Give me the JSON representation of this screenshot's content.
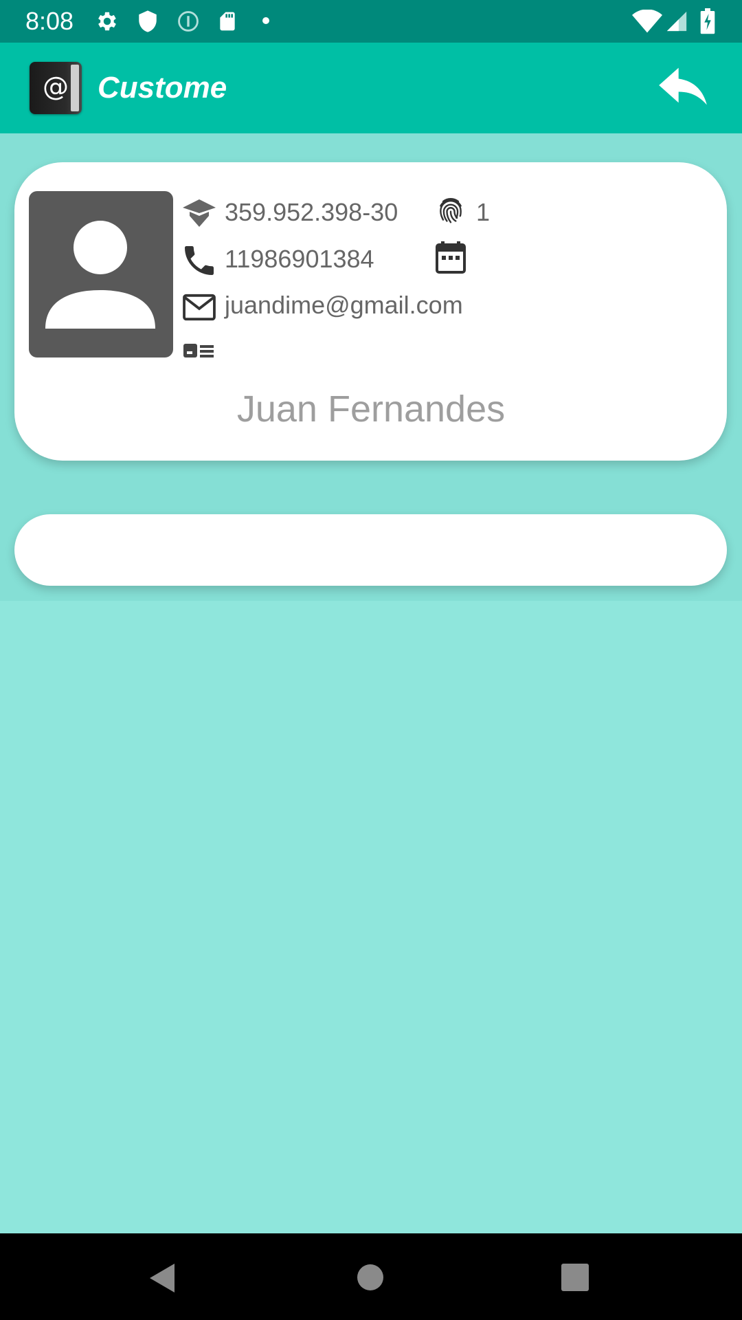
{
  "status_bar": {
    "time": "8:08",
    "icons": [
      "settings-icon",
      "shield-icon",
      "info-icon",
      "sd-card-icon",
      "dot-icon",
      "wifi-icon",
      "signal-icon",
      "battery-charging-icon"
    ]
  },
  "app_bar": {
    "title": "Custome",
    "logo_icon": "address-book-at-icon",
    "back_icon": "reply-icon"
  },
  "customer": {
    "cpf": "359.952.398-30",
    "id": "1",
    "phone": "11986901384",
    "birthday": "",
    "email": "juandime@gmail.com",
    "document": "",
    "name": "Juan Fernandes"
  },
  "colors": {
    "status_bar": "#00897b",
    "app_bar": "#00bfa5",
    "background": "#8fe6dc",
    "card": "#ffffff",
    "text": "#666666",
    "name": "#9e9e9e"
  },
  "nav_bar": {
    "icons": [
      "back-triangle-icon",
      "home-circle-icon",
      "recents-square-icon"
    ]
  }
}
